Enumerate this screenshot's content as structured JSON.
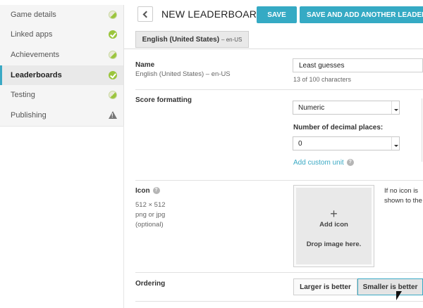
{
  "sidebar": {
    "items": [
      {
        "label": "Game details",
        "status": "partial"
      },
      {
        "label": "Linked apps",
        "status": "complete"
      },
      {
        "label": "Achievements",
        "status": "partial"
      },
      {
        "label": "Leaderboards",
        "status": "complete",
        "active": true
      },
      {
        "label": "Testing",
        "status": "partial"
      },
      {
        "label": "Publishing",
        "status": "warning"
      }
    ]
  },
  "header": {
    "back_icon": "chevron-left-icon",
    "title": "NEW LEADERBOARD",
    "save_label": "SAVE",
    "save_add_label": "SAVE AND ADD ANOTHER LEADERBOARD"
  },
  "language_tab": {
    "label": "English (United States)",
    "code": "– en-US"
  },
  "name_section": {
    "label": "Name",
    "language": "English (United States) – en-US",
    "value": "Least guesses",
    "counter": "13 of 100 characters"
  },
  "score_section": {
    "label": "Score formatting",
    "format_value": "Numeric",
    "decimal_label": "Number of decimal places:",
    "decimal_value": "0",
    "custom_unit_link": "Add custom unit"
  },
  "icon_section": {
    "label": "Icon",
    "size": "512 × 512",
    "type": "png or jpg",
    "optional": "(optional)",
    "plus": "+",
    "add_label": "Add icon",
    "drop_label": "Drop image here.",
    "note_line1": "If no icon is",
    "note_line2": "shown to the"
  },
  "ordering_section": {
    "label": "Ordering",
    "option_larger": "Larger is better",
    "option_smaller": "Smaller is better",
    "selected": "Smaller is better"
  },
  "colors": {
    "accent": "#35aac4",
    "complete": "#9bc53d",
    "warning": "#777777"
  }
}
